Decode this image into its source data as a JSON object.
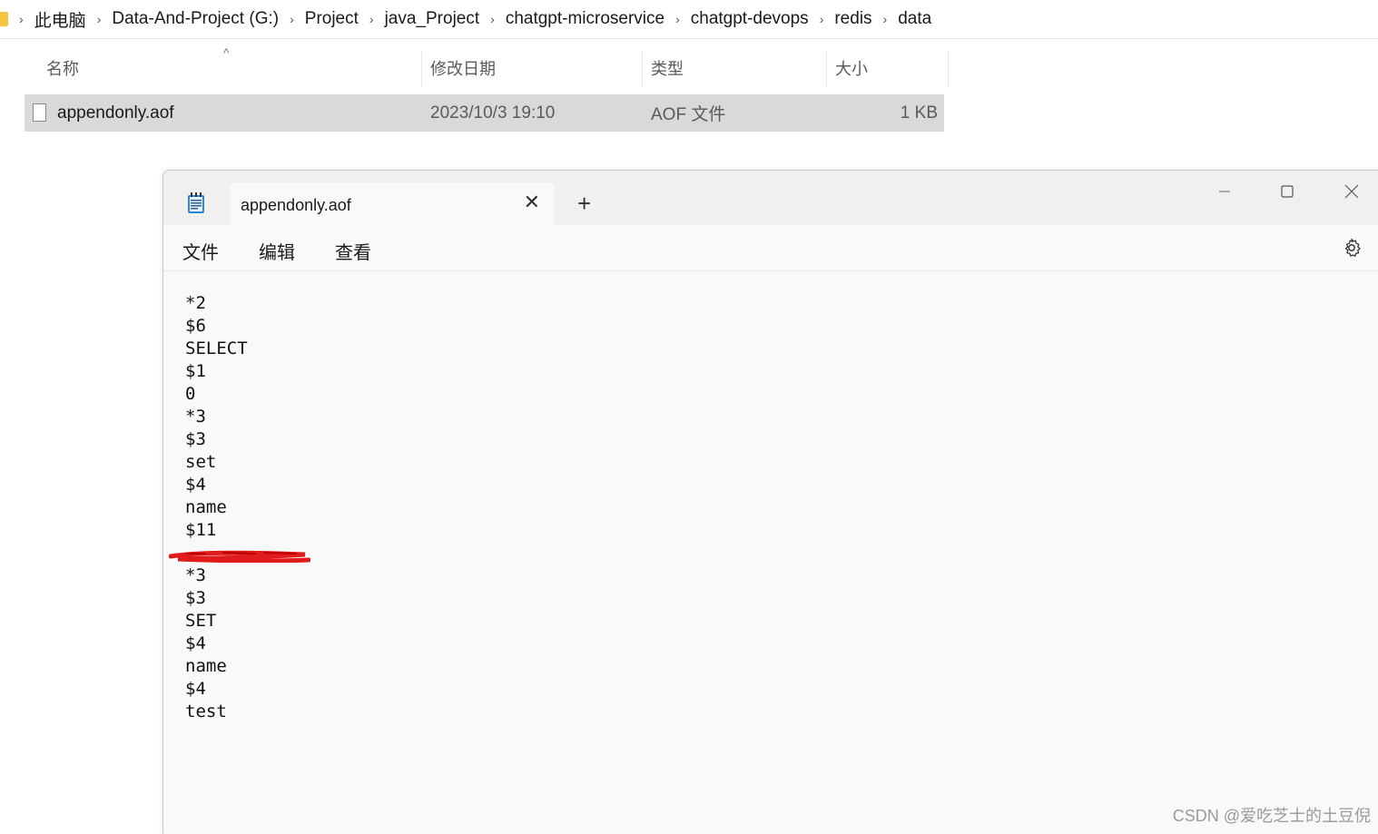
{
  "breadcrumb": {
    "items": [
      "此电脑",
      "Data-And-Project (G:)",
      "Project",
      "java_Project",
      "chatgpt-microservice",
      "chatgpt-devops",
      "redis",
      "data"
    ],
    "separator": "›"
  },
  "file_list": {
    "columns": {
      "name": "名称",
      "date": "修改日期",
      "type": "类型",
      "size": "大小"
    },
    "rows": [
      {
        "name": "appendonly.aof",
        "date": "2023/10/3 19:10",
        "type": "AOF 文件",
        "size": "1 KB"
      }
    ]
  },
  "notepad": {
    "tab_title": "appendonly.aof",
    "tab_close": "✕",
    "new_tab": "+",
    "menu": {
      "file": "文件",
      "edit": "编辑",
      "view": "查看"
    },
    "content_lines": [
      "*2",
      "$6",
      "SELECT",
      "$1",
      "0",
      "*3",
      "$3",
      "set",
      "$4",
      "name",
      "$11",
      "",
      "*3",
      "$3",
      "SET",
      "$4",
      "name",
      "$4",
      "test"
    ]
  },
  "watermark": "CSDN @爱吃芝士的土豆倪",
  "colors": {
    "redaction": "#e01b1b",
    "selected_row": "#d9d9d9",
    "folder": "#f5c542"
  }
}
